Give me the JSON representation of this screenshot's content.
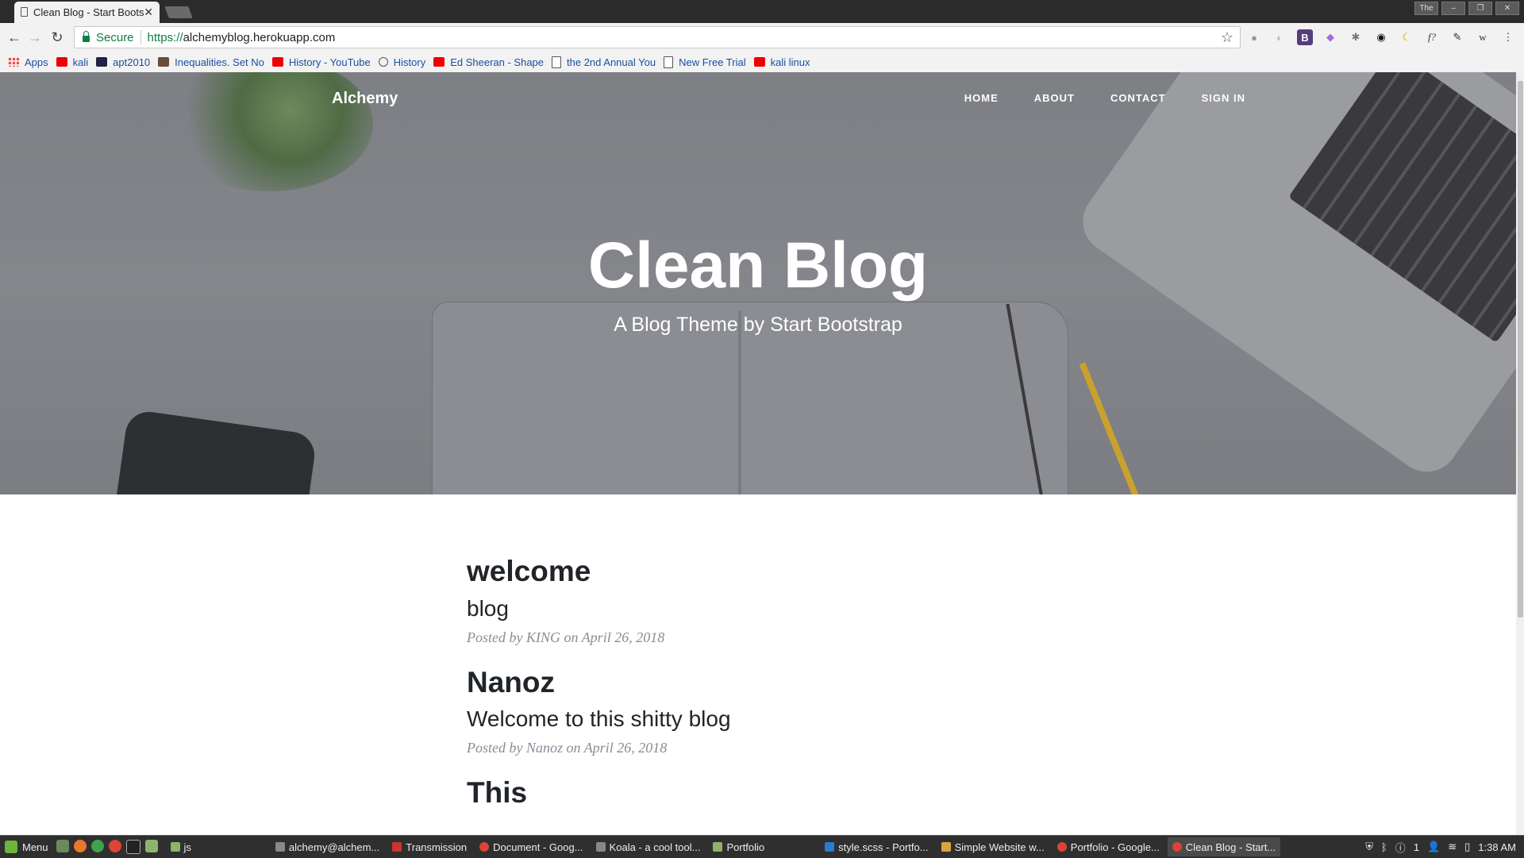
{
  "browser": {
    "tab_title": "Clean Blog - Start Bootstrap",
    "window_button_label": "The",
    "security_label": "Secure",
    "url_scheme": "https://",
    "url_host": "alchemyblog.herokuapp.com"
  },
  "bookmarks": [
    {
      "label": "Apps",
      "icon": "apps-icon"
    },
    {
      "label": "kali",
      "icon": "youtube-icon"
    },
    {
      "label": "apt2010",
      "icon": "j-icon"
    },
    {
      "label": "Inequalities. Set No",
      "icon": "image-icon"
    },
    {
      "label": "History - YouTube",
      "icon": "youtube-icon"
    },
    {
      "label": "History",
      "icon": "history-icon"
    },
    {
      "label": "Ed Sheeran - Shape",
      "icon": "youtube-icon"
    },
    {
      "label": "the 2nd Annual You",
      "icon": "document-icon"
    },
    {
      "label": "New Free Trial",
      "icon": "document-icon"
    },
    {
      "label": "kali linux",
      "icon": "youtube-icon"
    }
  ],
  "site": {
    "brand": "Alchemy",
    "nav": [
      "HOME",
      "ABOUT",
      "CONTACT",
      "SIGN IN"
    ],
    "hero_title": "Clean Blog",
    "hero_subtitle": "A Blog Theme by Start Bootstrap"
  },
  "posts": [
    {
      "title": "welcome",
      "subtitle": "blog",
      "posted_by": "Posted by",
      "author": "KING",
      "on": "on",
      "date": "April 26, 2018"
    },
    {
      "title": "Nanoz",
      "subtitle": "Welcome to this shitty blog",
      "posted_by": "Posted by",
      "author": "Nanoz",
      "on": "on",
      "date": "April 26, 2018"
    },
    {
      "title": "This",
      "subtitle": "",
      "posted_by": "",
      "author": "",
      "on": "",
      "date": ""
    }
  ],
  "taskbar": {
    "menu_label": "Menu",
    "folder_label": "js",
    "windows": [
      {
        "label": "alchemy@alchem...",
        "active": false
      },
      {
        "label": "Transmission",
        "active": false
      },
      {
        "label": "Document - Goog...",
        "active": false
      },
      {
        "label": "Koala - a cool tool...",
        "active": false
      },
      {
        "label": "Portfolio",
        "active": false
      },
      {
        "label": "style.scss - Portfo...",
        "active": false
      },
      {
        "label": "Simple Website w...",
        "active": false
      },
      {
        "label": "Portfolio - Google...",
        "active": false
      },
      {
        "label": "Clean Blog - Start...",
        "active": true
      }
    ],
    "tray_count": "1",
    "clock": "1:38 AM"
  }
}
